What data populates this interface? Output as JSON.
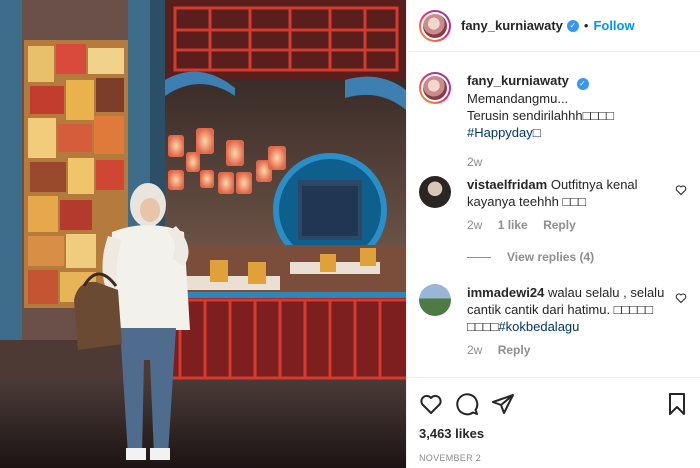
{
  "post": {
    "username": "fany_kurniawaty",
    "follow_label": "Follow",
    "likes": "3,463 likes",
    "date": "NOVEMBER 2"
  },
  "caption": {
    "username": "fany_kurniawaty",
    "text": "Memandangmu...",
    "line2": "Terusin sendirilahhh□□□□",
    "hashtag": "#Happyday□",
    "time": "2w"
  },
  "comments": [
    {
      "username": "vistaelfridam",
      "text": "Outfitnya kenal kayanya teehhh □□□",
      "time": "2w",
      "likes": "1 like",
      "reply_label": "Reply",
      "view_replies": "View replies (4)"
    },
    {
      "username": "immadewi24",
      "text": "walau selalu , selalu cantik cantik dari hatimu. □□□□□ □□□□",
      "hashtag": "#kokbedalagu",
      "time": "2w",
      "reply_label": "Reply"
    }
  ],
  "icons": [
    "heart-icon",
    "comment-icon",
    "share-icon",
    "bookmark-icon",
    "verified-icon"
  ],
  "colors": {
    "accent": "#0095f6",
    "verified": "#3897f0",
    "muted": "#8e8e8e"
  }
}
